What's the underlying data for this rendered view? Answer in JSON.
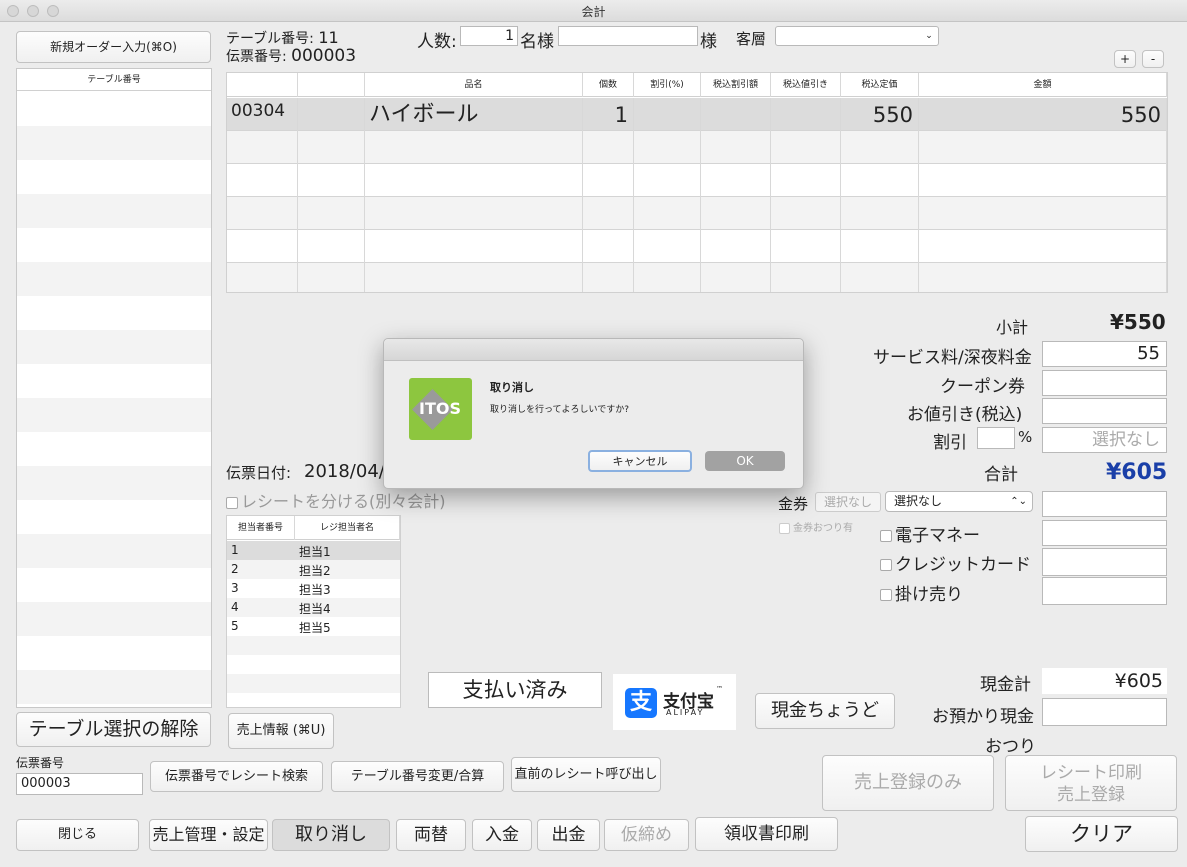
{
  "window": {
    "title": "会計"
  },
  "sidebar": {
    "new_order_label": "新規オーダー入力(⌘O)",
    "table_header": "テーブル番号",
    "release_button": "テーブル選択の解除"
  },
  "header": {
    "table_no_label": "テーブル番号:",
    "table_no": "11",
    "slip_no_label": "伝票番号:",
    "slip_no": "000003",
    "people_label": "人数:",
    "people": "1",
    "name_label": "名様",
    "sama_label": "様",
    "customer_label": "客層",
    "plus": "+",
    "minus": "-"
  },
  "items_table": {
    "headers": [
      "",
      "",
      "品名",
      "個数",
      "割引(%)",
      "税込割引額",
      "税込値引き",
      "税込定価",
      "金額"
    ],
    "rows": [
      [
        "00304",
        "",
        "ハイボール",
        "1",
        "",
        "",
        "",
        "550",
        "550"
      ]
    ]
  },
  "slip": {
    "date_label": "伝票日付:",
    "date": "2018/04/",
    "split_receipt": "レシートを分ける(別々会計)"
  },
  "staff_table": {
    "headers": [
      "担当者番号",
      "レジ担当者名"
    ],
    "rows": [
      [
        "1",
        "担当1"
      ],
      [
        "2",
        "担当2"
      ],
      [
        "3",
        "担当3"
      ],
      [
        "4",
        "担当4"
      ],
      [
        "5",
        "担当5"
      ]
    ]
  },
  "sales_info_label": "売上情報 (⌘U)",
  "totals": {
    "subtotal_label": "小計",
    "subtotal": "¥550",
    "service_label": "サービス料/深夜料金",
    "service": "55",
    "coupon_label": "クーポン券",
    "discount_yen_label": "お値引き(税込)",
    "discount_label": "割引",
    "percent": "%",
    "discount_placeholder": "選択なし",
    "total_label": "合計",
    "total": "¥605"
  },
  "payment": {
    "voucher_label": "金券",
    "voucher_tag": "選択なし",
    "voucher_select": "選択なし",
    "voucher_change": "金券おつり有",
    "emoney": "電子マネー",
    "credit": "クレジットカード",
    "credit_sale": "掛け売り"
  },
  "paid_label": "支払い済み",
  "alipay": {
    "cn": "支付宝",
    "en": "ALIPAY",
    "tm": "™"
  },
  "exact_cash_label": "現金ちょうど",
  "cash": {
    "total_label": "現金計",
    "total": "¥605",
    "deposit_label": "お預かり現金",
    "change_label": "おつり"
  },
  "bottom": {
    "slip_no_label": "伝票番号",
    "slip_no": "000003",
    "search_receipt": "伝票番号でレシート検索",
    "change_table": "テーブル番号変更/合算",
    "recall_receipt": "直前のレシート呼び出し",
    "register_only": "売上登録のみ",
    "print_register": [
      "レシート印刷",
      "売上登録"
    ],
    "close": "閉じる",
    "sales_mgmt": "売上管理・設定",
    "cancel": "取り消し",
    "exchange": "両替",
    "deposit": "入金",
    "withdraw": "出金",
    "temp_close": "仮締め",
    "print_receipt": "領収書印刷",
    "clear": "クリア"
  },
  "dialog": {
    "title": "取り消し",
    "message": "取り消しを行ってよろしいですか?",
    "cancel": "キャンセル",
    "ok": "OK",
    "logo_text": "ITOS"
  },
  "colors": {
    "total_blue": "#1a3fa8",
    "logo_green": "#8dc63f",
    "alipay_blue": "#1677ff"
  }
}
